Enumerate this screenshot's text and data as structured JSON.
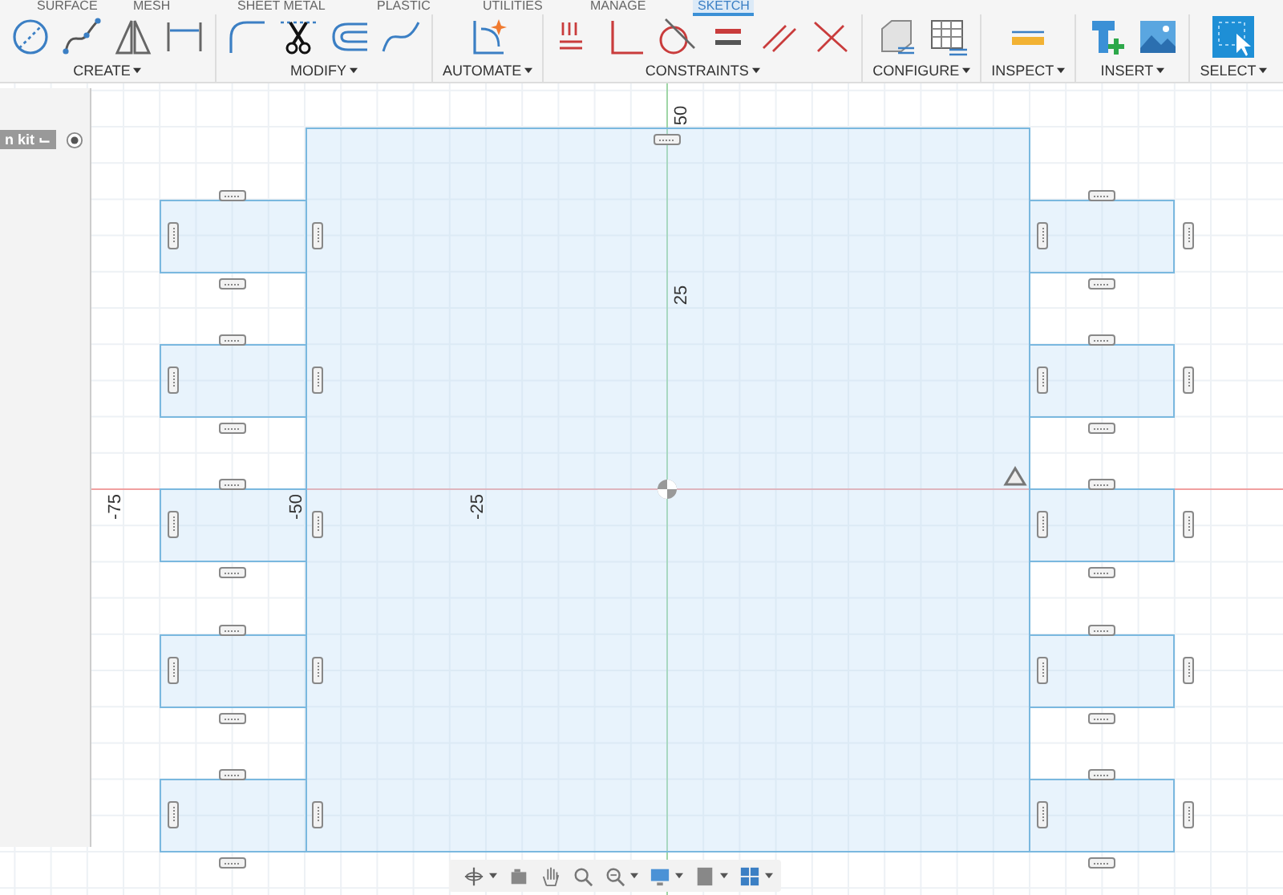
{
  "tabs": [
    {
      "label": "SURFACE",
      "selected": false
    },
    {
      "label": "MESH",
      "selected": false
    },
    {
      "label": "SHEET METAL",
      "selected": false
    },
    {
      "label": "PLASTIC",
      "selected": false
    },
    {
      "label": "UTILITIES",
      "selected": false
    },
    {
      "label": "MANAGE",
      "selected": false
    },
    {
      "label": "SKETCH",
      "selected": true
    }
  ],
  "toolbar_groups": [
    {
      "label": "CREATE"
    },
    {
      "label": "MODIFY"
    },
    {
      "label": "AUTOMATE"
    },
    {
      "label": "CONSTRAINTS"
    },
    {
      "label": "CONFIGURE"
    },
    {
      "label": "INSPECT"
    },
    {
      "label": "INSERT"
    },
    {
      "label": "SELECT"
    }
  ],
  "browser_panel": {
    "item": "n kit ⌙",
    "radio_selected": true
  },
  "canvas": {
    "vertical_ruler": [
      "50",
      "25"
    ],
    "horizontal_ruler": [
      "-75",
      "-50",
      "-25"
    ]
  }
}
